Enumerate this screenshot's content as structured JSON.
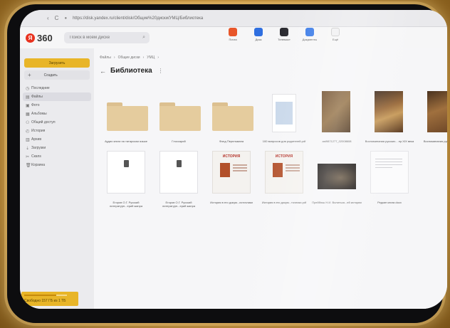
{
  "browser": {
    "url": "https://disk.yandex.ru/client/disk/Общие%20диски/УМЦ/Библиотека",
    "back_glyph": "‹",
    "reload_glyph": "C"
  },
  "header": {
    "logo_mark": "Я",
    "logo_text": "360",
    "search_placeholder": "Поиск в моём Диске",
    "services": [
      {
        "label": "Почта",
        "color": "#e8562a"
      },
      {
        "label": "Диск",
        "color": "#2f6fe0"
      },
      {
        "label": "Телемост",
        "color": "#2a2a30"
      },
      {
        "label": "Документы",
        "color": "#3a7be8"
      },
      {
        "label": "Ещё",
        "color": "#f0f0f2"
      }
    ]
  },
  "sidebar": {
    "upload_label": "Загрузить",
    "create_label": "Создать",
    "items": [
      {
        "icon": "◷",
        "label": "Последние"
      },
      {
        "icon": "▤",
        "label": "Файлы",
        "active": true
      },
      {
        "icon": "▣",
        "label": "Фото"
      },
      {
        "icon": "▦",
        "label": "Альбомы"
      },
      {
        "icon": "⚇",
        "label": "Общий доступ"
      },
      {
        "icon": "◴",
        "label": "История"
      },
      {
        "icon": "▥",
        "label": "Архив"
      },
      {
        "icon": "⇣",
        "label": "Загрузки"
      },
      {
        "icon": "✂",
        "label": "Скans"
      },
      {
        "icon": "🗑",
        "label": "Корзина"
      }
    ],
    "storage_text": "Свободно 157 ГБ из 1 ТБ",
    "storage_used": 0.75
  },
  "main": {
    "breadcrumbs": [
      "Файлы",
      "›",
      "Общие диски",
      "›",
      "УМЦ",
      "›"
    ],
    "title": "Библиотека",
    "items": [
      {
        "kind": "folder",
        "caption": "Аудио книги на татарском языке"
      },
      {
        "kind": "folder",
        "caption": "Глоссарий"
      },
      {
        "kind": "folder",
        "caption": "Фонд Перельмана"
      },
      {
        "kind": "book",
        "caption": "100 вопросов для родителей.pdf"
      },
      {
        "kind": "painting1",
        "caption": "ast9871277_02008608"
      },
      {
        "kind": "painting2",
        "caption": "Воспоминания русских... ер.XIX века"
      },
      {
        "kind": "painting3",
        "caption": "Воспоминания русских Х...Л"
      },
      {
        "kind": "doc",
        "caption": "Егоров О.Г. Русский литературн...ерий жанра"
      },
      {
        "kind": "doc",
        "caption": "Егоров О.Г. Русский литературн...ерий жанра"
      },
      {
        "kind": "history",
        "caption": "История в его докум...источники",
        "cover_title": "ИСТОРИЯ"
      },
      {
        "kind": "history",
        "caption": "История в его докум...точники.pdf",
        "cover_title": "ИСТОРИЯ"
      },
      {
        "kind": "photo",
        "caption": "Прейбюш Н.И. Волиться...ей истории"
      },
      {
        "kind": "plain",
        "caption": "Редкие книги.docx"
      }
    ]
  }
}
